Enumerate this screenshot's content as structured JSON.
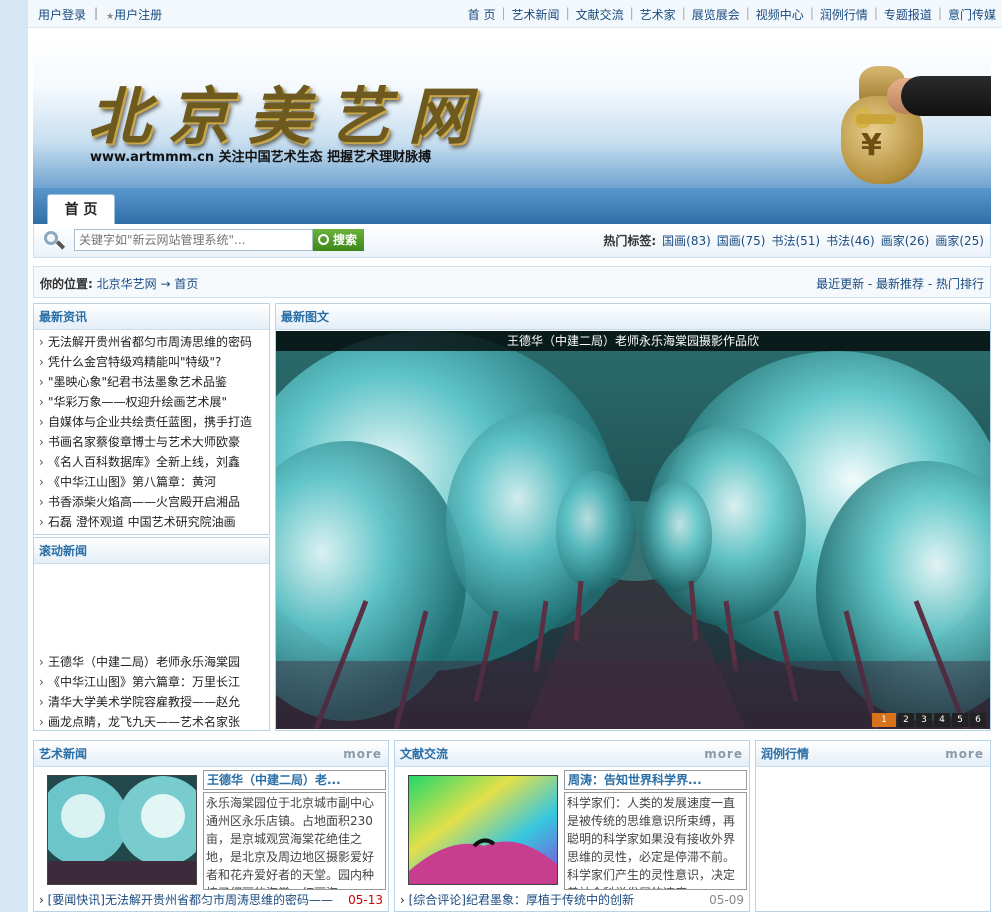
{
  "topbar": {
    "login": "用户登录",
    "register": "用户注册",
    "nav": [
      "首 页",
      "艺术新闻",
      "文献交流",
      "艺术家",
      "展览展会",
      "视频中心",
      "润例行情",
      "专题报道",
      "意门传媒"
    ]
  },
  "banner": {
    "logo": "北京美艺网",
    "tagline": "www.artmmm.cn 关注中国艺术生态 把握艺术理财脉搏",
    "bag_symbol": "¥"
  },
  "nav": {
    "home_tab": "首 页"
  },
  "search": {
    "placeholder": "关键字如\"新云网站管理系统\"...",
    "button": "搜索",
    "hot_label": "热门标签:",
    "tags": [
      "国画(83)",
      "国画(75)",
      "书法(51)",
      "书法(46)",
      "画家(26)",
      "画家(25)"
    ]
  },
  "crumb": {
    "label": "你的位置:",
    "site": "北京华艺网",
    "arrow": "→",
    "page": "首页",
    "right": "最近更新 - 最新推荐 - 热门排行"
  },
  "latest": {
    "title": "最新资讯",
    "items": [
      "无法解开贵州省都匀市周涛思维的密码",
      "凭什么金宫特级鸡精能叫\"特级\"?",
      "\"墨映心象\"纪君书法墨象艺术品鉴",
      "\"华彩万象——权迎升绘画艺术展\"",
      "自媒体与企业共绘责任蓝图，携手打造",
      "书画名家蔡俊章博士与艺术大师欧豪",
      "《名人百科数据库》全新上线，刘鑫",
      "《中华江山图》第八篇章：黄河",
      "书香添柴火焰高——火宫殿开启湘品",
      "石磊 澄怀观道 中国艺术研究院油画"
    ]
  },
  "scroll": {
    "title": "滚动新闻",
    "items": [
      "王德华（中建二局）老师永乐海棠园",
      "《中华江山图》第六篇章：万里长江",
      "清华大学美术学院容雇教授——赵允",
      "画龙点睛，龙飞九天——艺术名家张"
    ]
  },
  "gallery": {
    "title": "最新图文",
    "caption": "王德华（中建二局）老师永乐海棠园摄影作品欣",
    "pages": [
      "1",
      "2",
      "3",
      "4",
      "5",
      "6"
    ]
  },
  "artnews": {
    "title": "艺术新闻",
    "more": "more",
    "art_title": "王德华（中建二局）老...",
    "art_body": "永乐海棠园位于北京城市副中心通州区永乐店镇。占地面积230亩，是京城观赏海棠花绝佳之地，是北京及周边地区摄影爱好者和花卉爱好者的天堂。园内种植了细丽的海棠，红丽海...",
    "line": "[要闻快讯]无法解开贵州省都匀市周涛思维的密码——",
    "date": "05-13"
  },
  "docs": {
    "title": "文献交流",
    "more": "more",
    "art_title": "周涛：告知世界科学界...",
    "art_body": "科学家们：人类的发展速度一直是被传统的思维意识所束缚，再聪明的科学家如果没有接收外界思维的灵性，必定是停滞不前。科学家们产生的灵性意识，决定着社会科学发展的速度...",
    "line": "[综合评论]纪君墨象：厚植于传统中的创新",
    "date": "05-09"
  },
  "prices": {
    "title": "润例行情",
    "more": "more"
  }
}
